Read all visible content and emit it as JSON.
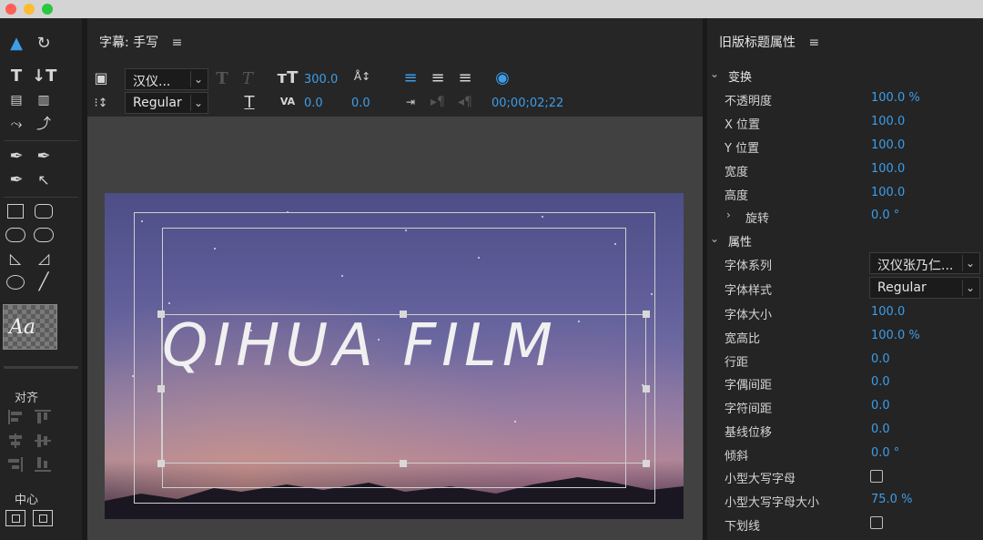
{
  "window": {
    "traffic_lights": [
      "#fe5f57",
      "#febc2e",
      "#28c840"
    ]
  },
  "editor": {
    "panel_title": "字幕: 手写",
    "toolbar": {
      "font_family": "汉仪...",
      "font_style": "Regular",
      "font_size": "300.0",
      "kerning": "0.0",
      "leading": "0.0",
      "timecode": "00;00;02;22"
    },
    "title_text": "QIHUA FILM"
  },
  "tools": {
    "style_sample": "Aa",
    "align_label": "对齐",
    "center_label": "中心"
  },
  "properties": {
    "panel_title": "旧版标题属性",
    "transform_section": "变换",
    "transform": [
      {
        "label": "不透明度",
        "value": "100.0 %"
      },
      {
        "label": "X 位置",
        "value": "100.0"
      },
      {
        "label": "Y 位置",
        "value": "100.0"
      },
      {
        "label": "宽度",
        "value": "100.0"
      },
      {
        "label": "高度",
        "value": "100.0"
      },
      {
        "label": "旋转",
        "value": "0.0 °"
      }
    ],
    "attributes_section": "属性",
    "font_family": {
      "label": "字体系列",
      "value": "汉仪张乃仁..."
    },
    "font_style": {
      "label": "字体样式",
      "value": "Regular"
    },
    "attributes": [
      {
        "label": "字体大小",
        "value": "100.0"
      },
      {
        "label": "宽高比",
        "value": "100.0 %"
      },
      {
        "label": "行距",
        "value": "0.0"
      },
      {
        "label": "字偶间距",
        "value": "0.0"
      },
      {
        "label": "字符间距",
        "value": "0.0"
      },
      {
        "label": "基线位移",
        "value": "0.0"
      },
      {
        "label": "倾斜",
        "value": "0.0 °"
      }
    ],
    "small_caps": {
      "label": "小型大写字母",
      "checked": false
    },
    "small_caps_size": {
      "label": "小型大写字母大小",
      "value": "75.0 %"
    },
    "underline": {
      "label": "下划线",
      "checked": false
    }
  }
}
